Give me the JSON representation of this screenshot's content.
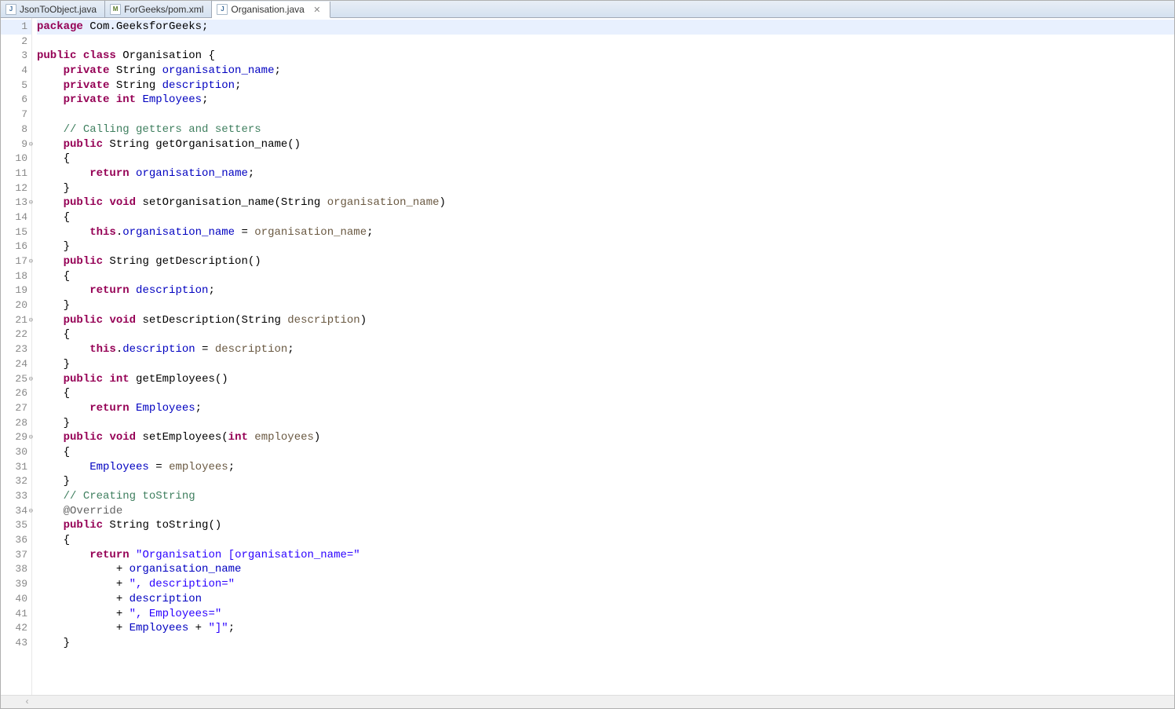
{
  "tabs": [
    {
      "label": "JsonToObject.java",
      "type": "java",
      "active": false
    },
    {
      "label": "ForGeeks/pom.xml",
      "type": "xml",
      "active": false
    },
    {
      "label": "Organisation.java",
      "type": "java",
      "active": true
    }
  ],
  "code": [
    {
      "n": "1",
      "highlight": true,
      "tokens": [
        [
          "kw",
          "package"
        ],
        [
          "",
          " Com.GeeksforGeeks;"
        ]
      ]
    },
    {
      "n": "2",
      "tokens": []
    },
    {
      "n": "3",
      "tokens": [
        [
          "kw",
          "public"
        ],
        [
          "",
          " "
        ],
        [
          "kw",
          "class"
        ],
        [
          "",
          " Organisation {"
        ]
      ]
    },
    {
      "n": "4",
      "tokens": [
        [
          "",
          "    "
        ],
        [
          "kw",
          "private"
        ],
        [
          "",
          " String "
        ],
        [
          "field",
          "organisation_name"
        ],
        [
          "",
          ";"
        ]
      ]
    },
    {
      "n": "5",
      "tokens": [
        [
          "",
          "    "
        ],
        [
          "kw",
          "private"
        ],
        [
          "",
          " String "
        ],
        [
          "field",
          "description"
        ],
        [
          "",
          ";"
        ]
      ]
    },
    {
      "n": "6",
      "tokens": [
        [
          "",
          "    "
        ],
        [
          "kw",
          "private"
        ],
        [
          "",
          " "
        ],
        [
          "kw",
          "int"
        ],
        [
          "",
          " "
        ],
        [
          "field",
          "Employees"
        ],
        [
          "",
          ";"
        ]
      ]
    },
    {
      "n": "7",
      "tokens": []
    },
    {
      "n": "8",
      "tokens": [
        [
          "",
          "    "
        ],
        [
          "comment",
          "// Calling getters and setters"
        ]
      ]
    },
    {
      "n": "9",
      "fold": true,
      "tokens": [
        [
          "",
          "    "
        ],
        [
          "kw",
          "public"
        ],
        [
          "",
          " String getOrganisation_name()"
        ]
      ]
    },
    {
      "n": "10",
      "tokens": [
        [
          "",
          "    {"
        ]
      ]
    },
    {
      "n": "11",
      "tokens": [
        [
          "",
          "        "
        ],
        [
          "kw",
          "return"
        ],
        [
          "",
          " "
        ],
        [
          "field",
          "organisation_name"
        ],
        [
          "",
          ";"
        ]
      ]
    },
    {
      "n": "12",
      "tokens": [
        [
          "",
          "    }"
        ]
      ]
    },
    {
      "n": "13",
      "fold": true,
      "tokens": [
        [
          "",
          "    "
        ],
        [
          "kw",
          "public"
        ],
        [
          "",
          " "
        ],
        [
          "kw",
          "void"
        ],
        [
          "",
          " setOrganisation_name(String "
        ],
        [
          "param",
          "organisation_name"
        ],
        [
          "",
          ")"
        ]
      ]
    },
    {
      "n": "14",
      "tokens": [
        [
          "",
          "    {"
        ]
      ]
    },
    {
      "n": "15",
      "tokens": [
        [
          "",
          "        "
        ],
        [
          "kw",
          "this"
        ],
        [
          "",
          "."
        ],
        [
          "field",
          "organisation_name"
        ],
        [
          "",
          " = "
        ],
        [
          "param",
          "organisation_name"
        ],
        [
          "",
          ";"
        ]
      ]
    },
    {
      "n": "16",
      "tokens": [
        [
          "",
          "    }"
        ]
      ]
    },
    {
      "n": "17",
      "fold": true,
      "tokens": [
        [
          "",
          "    "
        ],
        [
          "kw",
          "public"
        ],
        [
          "",
          " String getDescription()"
        ]
      ]
    },
    {
      "n": "18",
      "tokens": [
        [
          "",
          "    {"
        ]
      ]
    },
    {
      "n": "19",
      "tokens": [
        [
          "",
          "        "
        ],
        [
          "kw",
          "return"
        ],
        [
          "",
          " "
        ],
        [
          "field",
          "description"
        ],
        [
          "",
          ";"
        ]
      ]
    },
    {
      "n": "20",
      "tokens": [
        [
          "",
          "    }"
        ]
      ]
    },
    {
      "n": "21",
      "fold": true,
      "tokens": [
        [
          "",
          "    "
        ],
        [
          "kw",
          "public"
        ],
        [
          "",
          " "
        ],
        [
          "kw",
          "void"
        ],
        [
          "",
          " setDescription(String "
        ],
        [
          "param",
          "description"
        ],
        [
          "",
          ")"
        ]
      ]
    },
    {
      "n": "22",
      "tokens": [
        [
          "",
          "    {"
        ]
      ]
    },
    {
      "n": "23",
      "tokens": [
        [
          "",
          "        "
        ],
        [
          "kw",
          "this"
        ],
        [
          "",
          "."
        ],
        [
          "field",
          "description"
        ],
        [
          "",
          " = "
        ],
        [
          "param",
          "description"
        ],
        [
          "",
          ";"
        ]
      ]
    },
    {
      "n": "24",
      "tokens": [
        [
          "",
          "    }"
        ]
      ]
    },
    {
      "n": "25",
      "fold": true,
      "tokens": [
        [
          "",
          "    "
        ],
        [
          "kw",
          "public"
        ],
        [
          "",
          " "
        ],
        [
          "kw",
          "int"
        ],
        [
          "",
          " getEmployees()"
        ]
      ]
    },
    {
      "n": "26",
      "tokens": [
        [
          "",
          "    {"
        ]
      ]
    },
    {
      "n": "27",
      "tokens": [
        [
          "",
          "        "
        ],
        [
          "kw",
          "return"
        ],
        [
          "",
          " "
        ],
        [
          "field",
          "Employees"
        ],
        [
          "",
          ";"
        ]
      ]
    },
    {
      "n": "28",
      "tokens": [
        [
          "",
          "    }"
        ]
      ]
    },
    {
      "n": "29",
      "fold": true,
      "tokens": [
        [
          "",
          "    "
        ],
        [
          "kw",
          "public"
        ],
        [
          "",
          " "
        ],
        [
          "kw",
          "void"
        ],
        [
          "",
          " setEmployees("
        ],
        [
          "kw",
          "int"
        ],
        [
          "",
          " "
        ],
        [
          "param",
          "employees"
        ],
        [
          "",
          ")"
        ]
      ]
    },
    {
      "n": "30",
      "tokens": [
        [
          "",
          "    {"
        ]
      ]
    },
    {
      "n": "31",
      "tokens": [
        [
          "",
          "        "
        ],
        [
          "field",
          "Employees"
        ],
        [
          "",
          " = "
        ],
        [
          "param",
          "employees"
        ],
        [
          "",
          ";"
        ]
      ]
    },
    {
      "n": "32",
      "tokens": [
        [
          "",
          "    }"
        ]
      ]
    },
    {
      "n": "33",
      "tokens": [
        [
          "",
          "    "
        ],
        [
          "comment",
          "// Creating toString"
        ]
      ]
    },
    {
      "n": "34",
      "fold": true,
      "tokens": [
        [
          "",
          "    "
        ],
        [
          "ann",
          "@Override"
        ]
      ]
    },
    {
      "n": "35",
      "override": true,
      "tokens": [
        [
          "",
          "    "
        ],
        [
          "kw",
          "public"
        ],
        [
          "",
          " String toString()"
        ]
      ]
    },
    {
      "n": "36",
      "tokens": [
        [
          "",
          "    {"
        ]
      ]
    },
    {
      "n": "37",
      "tokens": [
        [
          "",
          "        "
        ],
        [
          "kw",
          "return"
        ],
        [
          "",
          " "
        ],
        [
          "str",
          "\"Organisation [organisation_name=\""
        ]
      ]
    },
    {
      "n": "38",
      "tokens": [
        [
          "",
          "            + "
        ],
        [
          "field",
          "organisation_name"
        ]
      ]
    },
    {
      "n": "39",
      "tokens": [
        [
          "",
          "            + "
        ],
        [
          "str",
          "\", description=\""
        ]
      ]
    },
    {
      "n": "40",
      "tokens": [
        [
          "",
          "            + "
        ],
        [
          "field",
          "description"
        ]
      ]
    },
    {
      "n": "41",
      "tokens": [
        [
          "",
          "            + "
        ],
        [
          "str",
          "\", Employees=\""
        ]
      ]
    },
    {
      "n": "42",
      "tokens": [
        [
          "",
          "            + "
        ],
        [
          "field",
          "Employees"
        ],
        [
          "",
          " + "
        ],
        [
          "str",
          "\"]\""
        ],
        [
          "",
          ";"
        ]
      ]
    },
    {
      "n": "43",
      "tokens": [
        [
          "",
          "    }"
        ]
      ]
    }
  ]
}
